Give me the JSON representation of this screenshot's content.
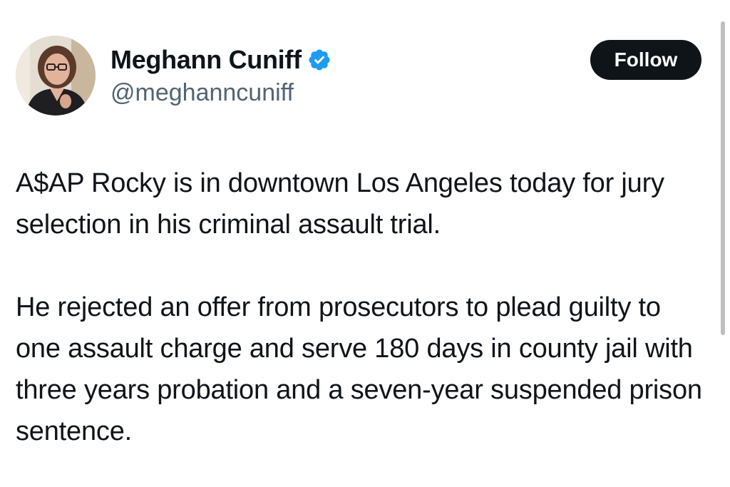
{
  "author": {
    "display_name": "Meghann Cuniff",
    "handle": "@meghanncuniff",
    "verified": true,
    "avatar": "profile-photo"
  },
  "actions": {
    "follow_label": "Follow"
  },
  "tweet": {
    "paragraphs": [
      "A$AP Rocky is in downtown Los Angeles today for jury selection in his criminal assault trial.",
      "He rejected an offer from prosecutors to plead guilty to one assault charge and serve 180 days in county jail with three years probation and a seven-year suspended prison sentence."
    ]
  },
  "colors": {
    "text": "#0f1419",
    "secondary_text": "#536471",
    "verified_badge": "#1d9bf0",
    "follow_button_bg": "#0f1419",
    "follow_button_text": "#ffffff"
  }
}
